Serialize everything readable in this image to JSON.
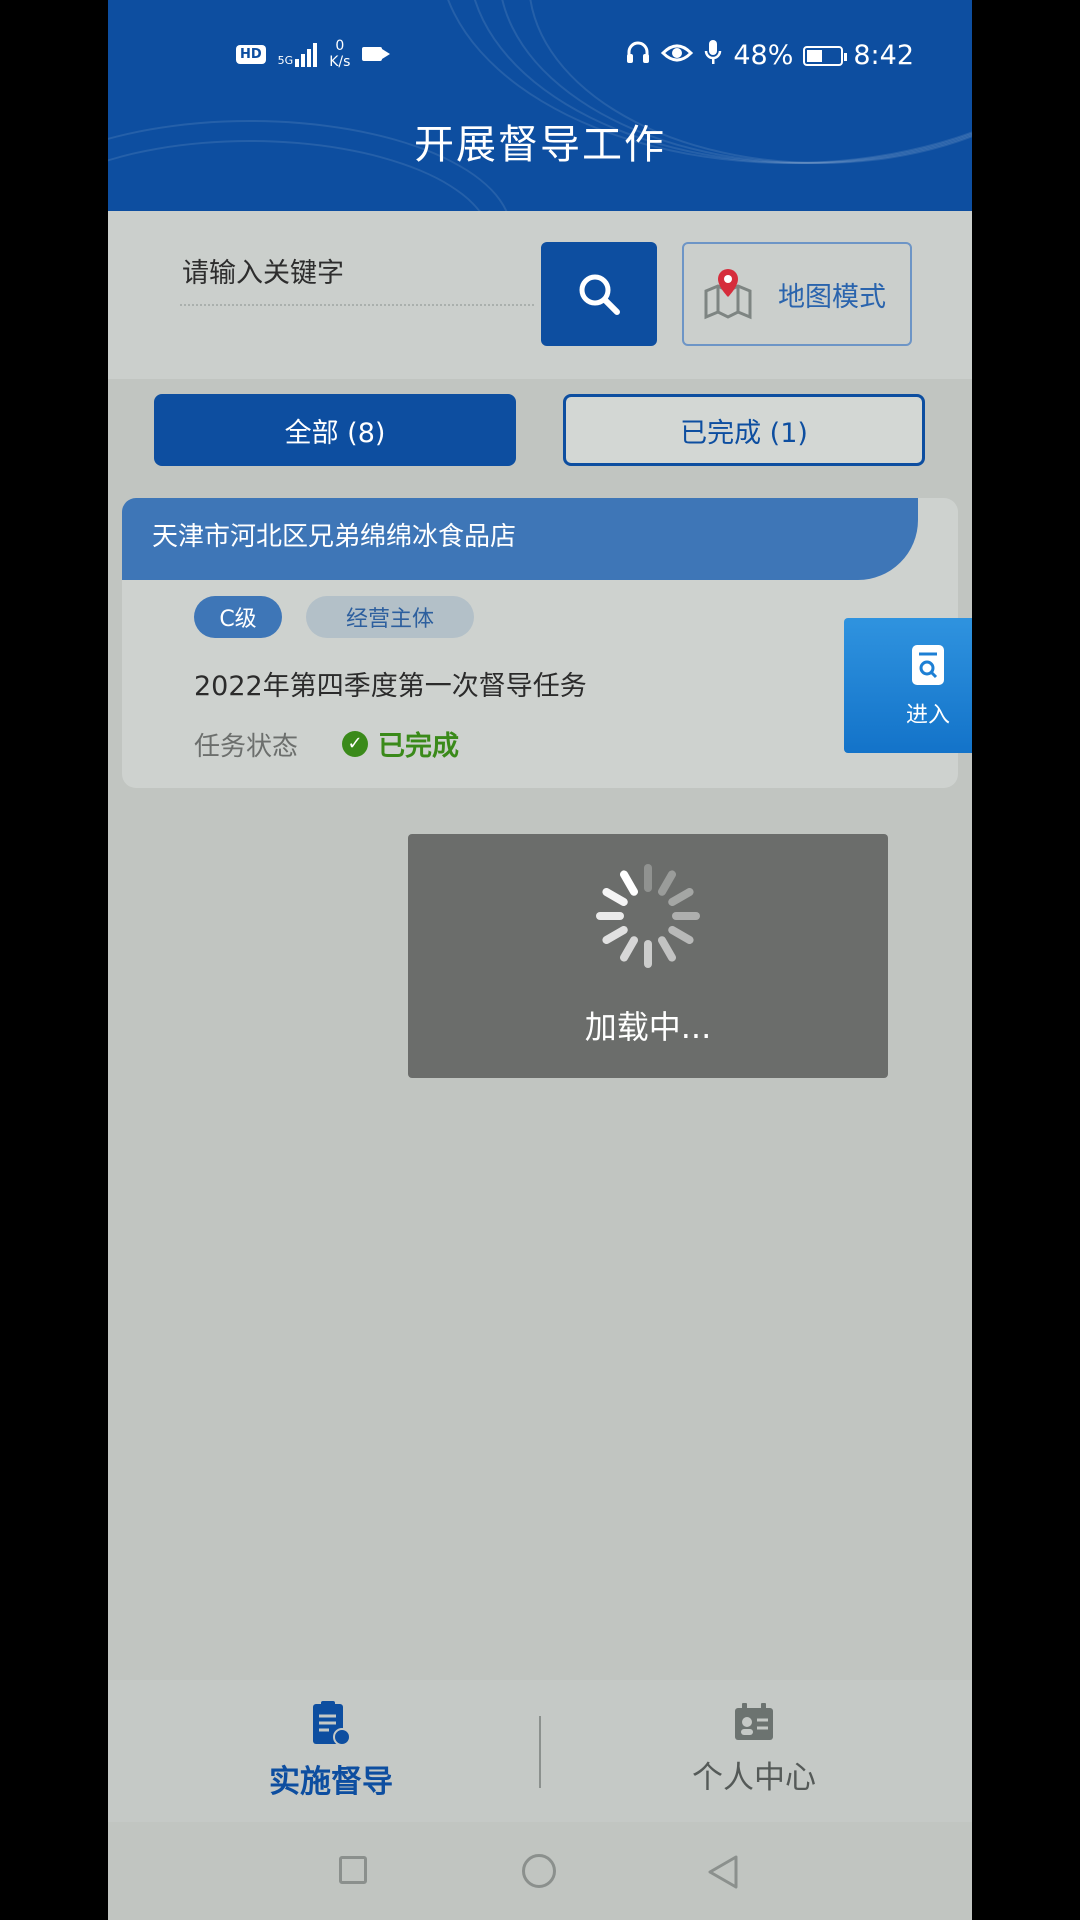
{
  "status_bar": {
    "hd": "HD",
    "network": "5G",
    "speed_value": "0",
    "speed_unit": "K/s",
    "battery": "48%",
    "battery_level": 0.48,
    "time": "8:42"
  },
  "header": {
    "title": "开展督导工作"
  },
  "search": {
    "placeholder": "请输入关键字",
    "map_mode_label": "地图模式"
  },
  "tabs": [
    {
      "label": "全部 (8)",
      "active": true
    },
    {
      "label": "已完成 (1)",
      "active": false
    }
  ],
  "tasks": [
    {
      "store_name": "天津市河北区兄弟绵绵冰食品店",
      "level": "C级",
      "subject_type": "经营主体",
      "task_name": "2022年第四季度第一次督导任务",
      "status_label": "任务状态",
      "status": "已完成",
      "enter_label": "进入"
    }
  ],
  "loading": {
    "text": "加载中..."
  },
  "bottom_nav": [
    {
      "label": "实施督导",
      "icon": "clipboard-icon",
      "active": true
    },
    {
      "label": "个人中心",
      "icon": "id-card-icon",
      "active": false
    }
  ],
  "colors": {
    "primary": "#0d4ea0",
    "accent": "#3e76b7",
    "success": "#3a8a1a"
  }
}
